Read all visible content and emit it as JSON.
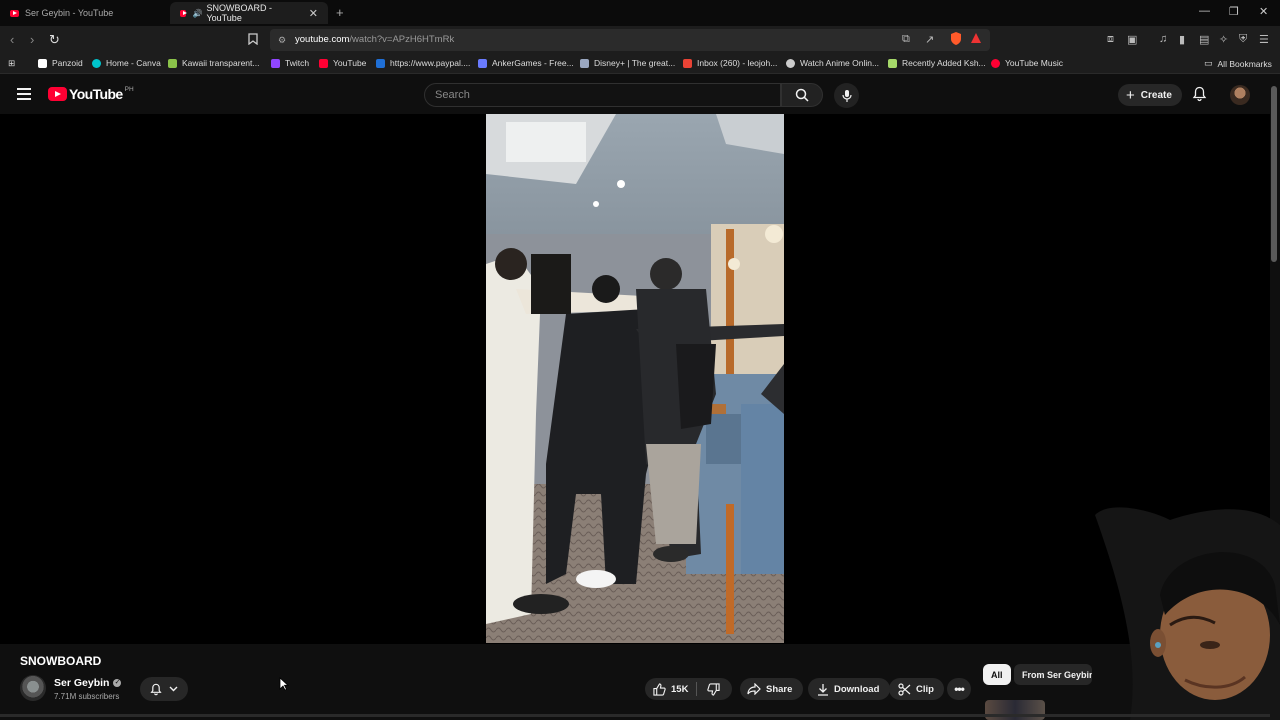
{
  "browser": {
    "tabs": [
      {
        "label": "Ser Geybin - YouTube",
        "active": false
      },
      {
        "label": "SNOWBOARD - YouTube",
        "active": true
      }
    ],
    "url": {
      "host": "youtube.com",
      "path": "/watch?v=APzH6HTmRk"
    },
    "bookmarks": [
      {
        "label": "Panzoid",
        "icon": "panzoid-icon",
        "color": "#ffffff"
      },
      {
        "label": "Home - Canva",
        "icon": "canva-icon",
        "color": "#00c4cc"
      },
      {
        "label": "Kawaii transparent...",
        "icon": "kawaii-icon",
        "color": "#8bc34a"
      },
      {
        "label": "Twitch",
        "icon": "twitch-icon",
        "color": "#9146ff"
      },
      {
        "label": "YouTube",
        "icon": "youtube-icon",
        "color": "#ff0033"
      },
      {
        "label": "https://www.paypal....",
        "icon": "paypal-icon",
        "color": "#1f6fd6"
      },
      {
        "label": "AnkerGames - Free...",
        "icon": "ankergames-icon",
        "color": "#6a7bff"
      },
      {
        "label": "Disney+ | The great...",
        "icon": "disney-icon",
        "color": "#9aa7c0"
      },
      {
        "label": "Inbox (260) - leojoh...",
        "icon": "gmail-icon",
        "color": "#ea4335"
      },
      {
        "label": "Watch Anime Onlin...",
        "icon": "anime-icon",
        "color": "#cccccc"
      },
      {
        "label": "Recently Added Ksh...",
        "icon": "kshow-icon",
        "color": "#a6d96a"
      },
      {
        "label": "YouTube Music",
        "icon": "youtube-music-icon",
        "color": "#ff0033"
      }
    ],
    "all_bookmarks": "All Bookmarks"
  },
  "youtube": {
    "logo_text": "YouTube",
    "country_code": "PH",
    "search_placeholder": "Search",
    "create_label": "Create"
  },
  "video": {
    "title": "SNOWBOARD",
    "channel": "Ser Geybin",
    "subscribers": "7.71M subscribers",
    "likes": "15K",
    "share_label": "Share",
    "download_label": "Download",
    "clip_label": "Clip"
  },
  "related_chips": [
    {
      "label": "All",
      "selected": true
    },
    {
      "label": "From Ser Geybin",
      "selected": false
    }
  ]
}
